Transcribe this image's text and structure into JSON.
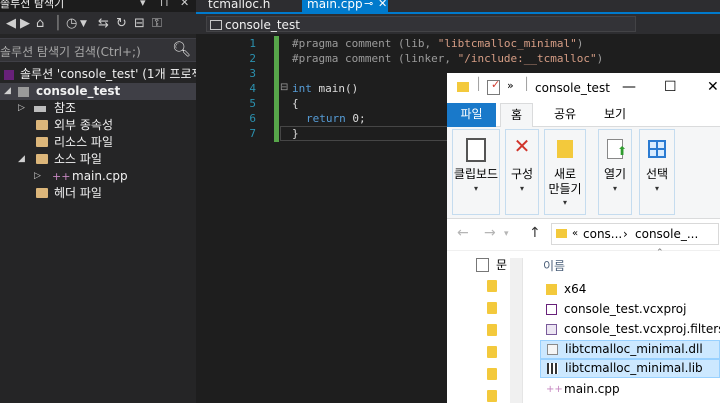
{
  "solution_explorer": {
    "title": "솔루션 탐색기",
    "search_placeholder": "솔루션 탐색기 검색(Ctrl+;)",
    "tree": [
      {
        "label": "솔루션 'console_test' (1개 프로젝트"
      },
      {
        "label": "console_test"
      },
      {
        "label": "참조"
      },
      {
        "label": "외부 종속성"
      },
      {
        "label": "리소스 파일"
      },
      {
        "label": "소스 파일"
      },
      {
        "label": "main.cpp"
      },
      {
        "label": "헤더 파일"
      }
    ]
  },
  "editor": {
    "tabs": [
      {
        "label": "tcmalloc.h"
      },
      {
        "label": "main.cpp"
      }
    ],
    "nav_project": "console_test",
    "lines": [
      {
        "num": "1",
        "pre": "#pragma comment (lib, ",
        "str": "\"libtcmalloc_minimal\"",
        "post": ")"
      },
      {
        "num": "2",
        "pre": "#pragma comment (linker, ",
        "str": "\"/include:__tcmalloc\"",
        "post": ")"
      },
      {
        "num": "3"
      },
      {
        "num": "4",
        "kw": "int",
        "rest": " main()"
      },
      {
        "num": "5",
        "text": "{"
      },
      {
        "num": "6",
        "kw": "return",
        "rest": " 0;"
      },
      {
        "num": "7",
        "text": "}"
      }
    ]
  },
  "file_explorer": {
    "title": "console_test",
    "ribbon_tabs": [
      "파일",
      "홈",
      "공유",
      "보기"
    ],
    "ribbon_buttons": [
      {
        "label": "클립보드",
        "icon": "clipboard-icon"
      },
      {
        "label": "구성",
        "icon": "delete-x-icon"
      },
      {
        "label1": "새로",
        "label2": "만들기",
        "icon": "new-folder-icon"
      },
      {
        "label": "열기",
        "icon": "open-properties-icon"
      },
      {
        "label": "선택",
        "icon": "select-grid-icon"
      }
    ],
    "breadcrumb": [
      "cons...",
      "console_..."
    ],
    "column_header": "이름",
    "left_pane_label": "문",
    "files": [
      {
        "name": "x64",
        "icon": "folder-icon"
      },
      {
        "name": "console_test.vcxproj",
        "icon": "vcxproj-icon"
      },
      {
        "name": "console_test.vcxproj.filters",
        "icon": "filters-icon"
      },
      {
        "name": "libtcmalloc_minimal.dll",
        "icon": "dll-icon"
      },
      {
        "name": "libtcmalloc_minimal.lib",
        "icon": "lib-icon"
      },
      {
        "name": "main.cpp",
        "icon": "cpp-icon"
      }
    ]
  }
}
